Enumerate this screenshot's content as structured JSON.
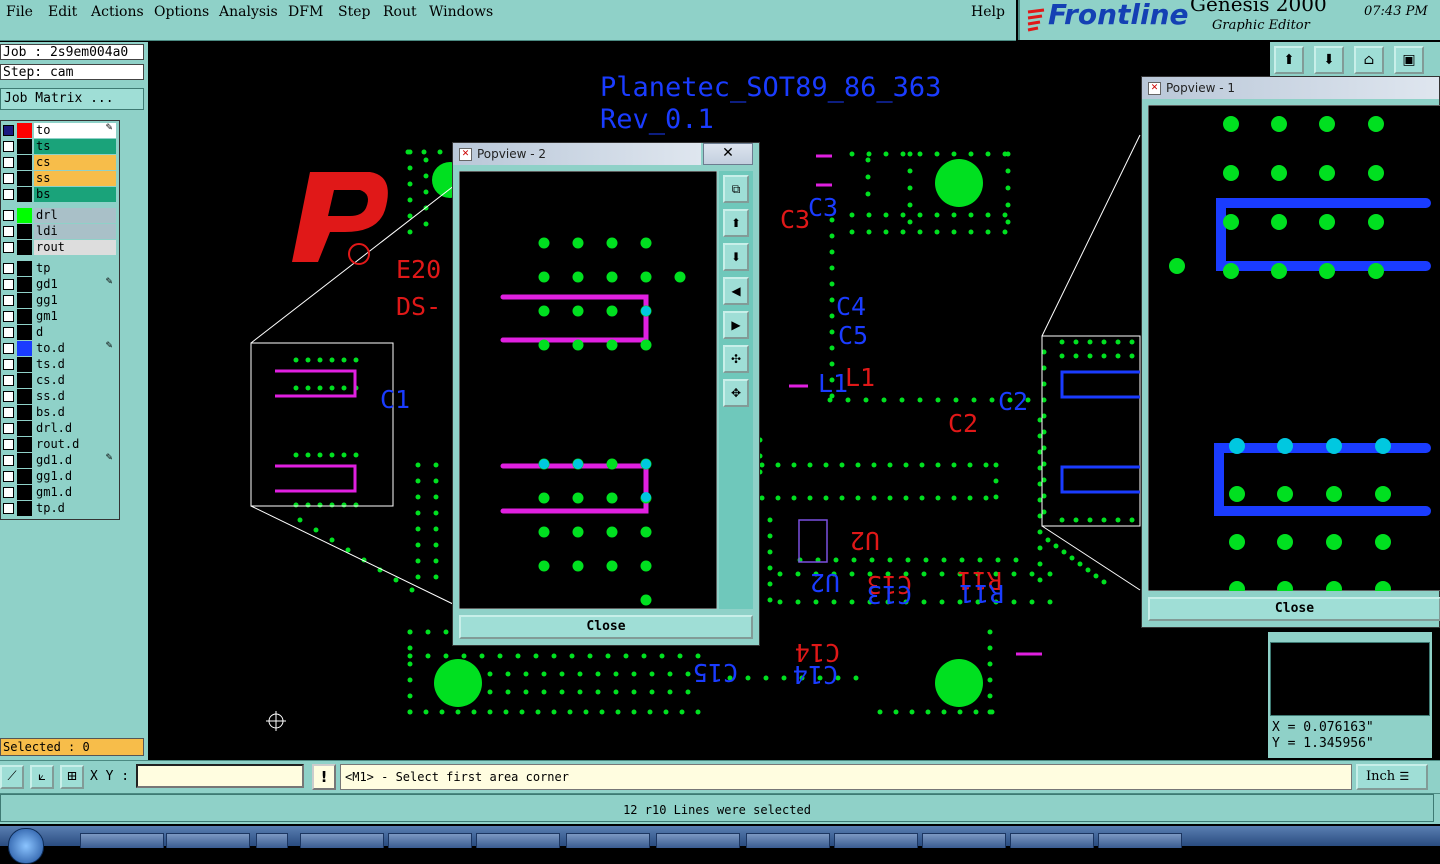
{
  "menu": {
    "items": [
      "File",
      "Edit",
      "Actions",
      "Options",
      "Analysis",
      "DFM",
      "Step",
      "Rout",
      "Windows"
    ],
    "help": "Help"
  },
  "brand": {
    "logo": "Frontline",
    "product": "Genesis 2000",
    "subtitle": "Graphic Editor",
    "time": "07:43 PM"
  },
  "job": {
    "job_line": "Job : 2s9em004a0",
    "step_line": "Step: cam",
    "job_matrix": "Job Matrix ..."
  },
  "layers": [
    {
      "name": "to",
      "color": "#ffffff",
      "swatch": "#ff0000",
      "checked": true,
      "edit": true
    },
    {
      "name": "ts",
      "color": "#1aa37a",
      "swatch": "#000000",
      "checked": false,
      "edit": false
    },
    {
      "name": "cs",
      "color": "#f7bd4a",
      "swatch": "#000000",
      "checked": false,
      "edit": false
    },
    {
      "name": "ss",
      "color": "#f7bd4a",
      "swatch": "#000000",
      "checked": false,
      "edit": false
    },
    {
      "name": "bs",
      "color": "#1aa37a",
      "swatch": "#000000",
      "checked": false,
      "edit": false
    },
    {
      "name": "drl",
      "color": "#a9c0c8",
      "swatch": "#00ff00",
      "checked": false,
      "edit": false
    },
    {
      "name": "ldi",
      "color": "#a9c0c8",
      "swatch": "#000000",
      "checked": false,
      "edit": false
    },
    {
      "name": "rout",
      "color": "#dddddd",
      "swatch": "#000000",
      "checked": false,
      "edit": false
    },
    {
      "name": "tp",
      "color": "#8fd1c8",
      "swatch": "#000000",
      "checked": false,
      "edit": false
    },
    {
      "name": "gd1",
      "color": "#8fd1c8",
      "swatch": "#000000",
      "checked": false,
      "edit": true
    },
    {
      "name": "gg1",
      "color": "#8fd1c8",
      "swatch": "#000000",
      "checked": false,
      "edit": false
    },
    {
      "name": "gm1",
      "color": "#8fd1c8",
      "swatch": "#000000",
      "checked": false,
      "edit": false
    },
    {
      "name": "d",
      "color": "#8fd1c8",
      "swatch": "#000000",
      "checked": false,
      "edit": false
    },
    {
      "name": "to.d",
      "color": "#8fd1c8",
      "swatch": "#1a3cff",
      "checked": false,
      "edit": true
    },
    {
      "name": "ts.d",
      "color": "#8fd1c8",
      "swatch": "#000000",
      "checked": false,
      "edit": false
    },
    {
      "name": "cs.d",
      "color": "#8fd1c8",
      "swatch": "#000000",
      "checked": false,
      "edit": false
    },
    {
      "name": "ss.d",
      "color": "#8fd1c8",
      "swatch": "#000000",
      "checked": false,
      "edit": false
    },
    {
      "name": "bs.d",
      "color": "#8fd1c8",
      "swatch": "#000000",
      "checked": false,
      "edit": false
    },
    {
      "name": "drl.d",
      "color": "#8fd1c8",
      "swatch": "#000000",
      "checked": false,
      "edit": false
    },
    {
      "name": "rout.d",
      "color": "#8fd1c8",
      "swatch": "#000000",
      "checked": false,
      "edit": false
    },
    {
      "name": "gd1.d",
      "color": "#8fd1c8",
      "swatch": "#000000",
      "checked": false,
      "edit": true
    },
    {
      "name": "gg1.d",
      "color": "#8fd1c8",
      "swatch": "#000000",
      "checked": false,
      "edit": false
    },
    {
      "name": "gm1.d",
      "color": "#8fd1c8",
      "swatch": "#000000",
      "checked": false,
      "edit": false
    },
    {
      "name": "tp.d",
      "color": "#8fd1c8",
      "swatch": "#000000",
      "checked": false,
      "edit": false
    }
  ],
  "selected": "Selected : 0",
  "canvas": {
    "title_line1": "Planetec_SOT89_86_363",
    "title_line2": "Rev_0.1",
    "labels": {
      "e20": "E20",
      "ds": "DS-",
      "c1": "C1",
      "c3_red": "C3",
      "c3_blue": "C3",
      "c4": "C4",
      "c5": "C5",
      "l1_red": "L1",
      "l1_blue": "L1",
      "c2_red": "C2",
      "c2_blue": "C2",
      "u2_red": "U2",
      "u2_blue": "U2",
      "c13_red": "C13",
      "c13_blue": "C13",
      "r11_red": "R11",
      "r11_blue": "R11",
      "c14_red": "C14",
      "c14_blue": "C14",
      "c15": "C15"
    }
  },
  "popview2": {
    "title": "Popview - 2",
    "close": "Close"
  },
  "popview1": {
    "title": "Popview - 1",
    "close": "Close"
  },
  "coords": {
    "x": "X = 0.076163\"",
    "y": "Y = 1.345956\""
  },
  "command": {
    "xy_label": "X Y :",
    "xy_value": "",
    "prompt": "<M1> - Select first area corner",
    "units": "Inch"
  },
  "status": "12 r10 Lines were selected",
  "colors": {
    "panel": "#8fd1c8",
    "pad_green": "#00e020",
    "trace_magenta": "#e020e0",
    "trace_blue": "#1a3cff",
    "label_red": "#e01818",
    "label_blue": "#1a3cff"
  }
}
